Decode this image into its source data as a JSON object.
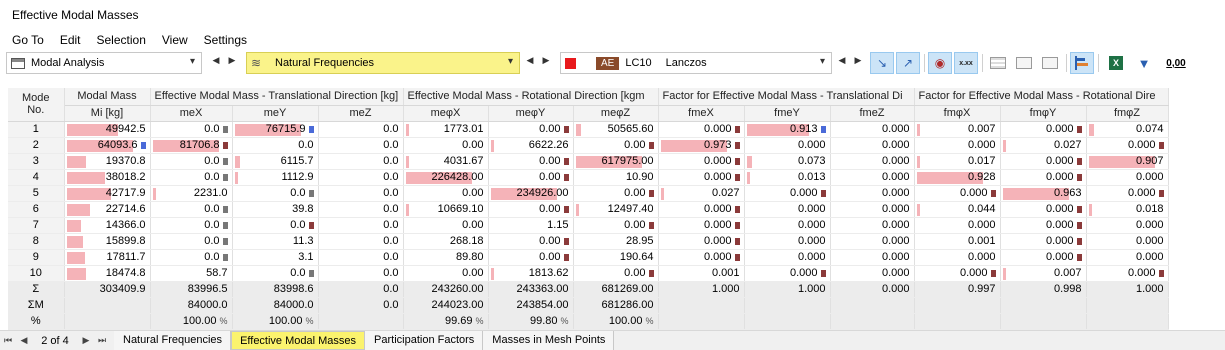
{
  "window": {
    "title": "Effective Modal Masses"
  },
  "menu": [
    "Go To",
    "Edit",
    "Selection",
    "View",
    "Settings"
  ],
  "toolbar": {
    "analysis": "Modal Analysis",
    "result": "Natural Frequencies",
    "lc_badge": "AE",
    "lc_id": "LC10",
    "method": "Lanczos",
    "decimals_label": "0,00"
  },
  "table": {
    "group_headers": [
      "Mode No.",
      "Modal Mass",
      "Effective Modal Mass - Translational Direction [kg]",
      "Effective Modal Mass - Rotational Direction [kgm",
      "Factor for Effective Modal Mass - Translational Di",
      "Factor for Effective Modal Mass - Rotational Dire"
    ],
    "col_headers": [
      "Mi [kg]",
      "meX",
      "meY",
      "meZ",
      "meφX",
      "meφY",
      "meφZ",
      "fmeX",
      "fmeY",
      "fmeZ",
      "fmφX",
      "fmφY",
      "fmφZ"
    ],
    "mode_label_1": "Mode",
    "mode_label_2": "No.",
    "rows": [
      {
        "mode": "1",
        "cells": [
          "49942.5",
          "0.0",
          "76715.9",
          "0.0",
          "1773.01",
          "0.00",
          "50565.60",
          "0.000",
          "0.913",
          "0.000",
          "0.007",
          "0.000",
          "0.074"
        ]
      },
      {
        "mode": "2",
        "cells": [
          "64093.6",
          "81706.8",
          "0.0",
          "0.0",
          "0.00",
          "6622.26",
          "0.00",
          "0.973",
          "0.000",
          "0.000",
          "0.000",
          "0.027",
          "0.000"
        ]
      },
      {
        "mode": "3",
        "cells": [
          "19370.8",
          "0.0",
          "6115.7",
          "0.0",
          "4031.67",
          "0.00",
          "617975.00",
          "0.000",
          "0.073",
          "0.000",
          "0.017",
          "0.000",
          "0.907"
        ]
      },
      {
        "mode": "4",
        "cells": [
          "38018.2",
          "0.0",
          "1112.9",
          "0.0",
          "226428.00",
          "0.00",
          "10.90",
          "0.000",
          "0.013",
          "0.000",
          "0.928",
          "0.000",
          "0.000"
        ]
      },
      {
        "mode": "5",
        "cells": [
          "42717.9",
          "2231.0",
          "0.0",
          "0.0",
          "0.00",
          "234926.00",
          "0.00",
          "0.027",
          "0.000",
          "0.000",
          "0.000",
          "0.963",
          "0.000"
        ]
      },
      {
        "mode": "6",
        "cells": [
          "22714.6",
          "0.0",
          "39.8",
          "0.0",
          "10669.10",
          "0.00",
          "12497.40",
          "0.000",
          "0.000",
          "0.000",
          "0.044",
          "0.000",
          "0.018"
        ]
      },
      {
        "mode": "7",
        "cells": [
          "14366.0",
          "0.0",
          "0.0",
          "0.0",
          "0.00",
          "1.15",
          "0.00",
          "0.000",
          "0.000",
          "0.000",
          "0.000",
          "0.000",
          "0.000"
        ]
      },
      {
        "mode": "8",
        "cells": [
          "15899.8",
          "0.0",
          "11.3",
          "0.0",
          "268.18",
          "0.00",
          "28.95",
          "0.000",
          "0.000",
          "0.000",
          "0.001",
          "0.000",
          "0.000"
        ]
      },
      {
        "mode": "9",
        "cells": [
          "17811.7",
          "0.0",
          "3.1",
          "0.0",
          "89.80",
          "0.00",
          "190.64",
          "0.000",
          "0.000",
          "0.000",
          "0.000",
          "0.000",
          "0.000"
        ]
      },
      {
        "mode": "10",
        "cells": [
          "18474.8",
          "58.7",
          "0.0",
          "0.0",
          "0.00",
          "1813.62",
          "0.00",
          "0.001",
          "0.000",
          "0.000",
          "0.000",
          "0.007",
          "0.000"
        ]
      }
    ],
    "summary": [
      {
        "label": "Σ",
        "cells": [
          "303409.9",
          "83996.5",
          "83998.6",
          "0.0",
          "243260.00",
          "243363.00",
          "681269.00",
          "1.000",
          "1.000",
          "0.000",
          "0.997",
          "0.998",
          "1.000"
        ]
      },
      {
        "label": "ΣM",
        "cells": [
          "",
          "84000.0",
          "84000.0",
          "0.0",
          "244023.00",
          "243854.00",
          "681286.00",
          "",
          "",
          "",
          "",
          "",
          ""
        ]
      },
      {
        "label": "%",
        "cells": [
          "",
          "100.00",
          "100.00",
          "",
          "99.69",
          "99.80",
          "100.00",
          "",
          "",
          "",
          "",
          "",
          ""
        ]
      }
    ],
    "percent_unit": "%"
  },
  "bars": {
    "rows": [
      [
        0.78,
        0,
        1.0,
        0,
        0.01,
        0,
        0.08,
        0,
        0.94,
        0,
        0.01,
        0,
        0.08
      ],
      [
        1.0,
        1.0,
        0,
        0,
        0,
        0.03,
        0,
        1.0,
        0,
        0,
        0,
        0.03,
        0
      ],
      [
        0.3,
        0,
        0.08,
        0,
        0.02,
        0,
        1.0,
        0,
        0.08,
        0,
        0.02,
        0,
        1.0
      ],
      [
        0.59,
        0,
        0.01,
        0,
        1.0,
        0,
        0,
        0,
        0.01,
        0,
        1.0,
        0,
        0
      ],
      [
        0.67,
        0.03,
        0,
        0,
        0,
        1.0,
        0,
        0.03,
        0,
        0,
        0,
        1.0,
        0
      ],
      [
        0.35,
        0,
        0,
        0,
        0.05,
        0,
        0.02,
        0,
        0,
        0,
        0.05,
        0,
        0.02
      ],
      [
        0.22,
        0,
        0,
        0,
        0,
        0,
        0,
        0,
        0,
        0,
        0,
        0,
        0
      ],
      [
        0.25,
        0,
        0,
        0,
        0,
        0,
        0,
        0,
        0,
        0,
        0,
        0,
        0
      ],
      [
        0.28,
        0,
        0,
        0,
        0,
        0,
        0,
        0,
        0,
        0,
        0,
        0,
        0
      ],
      [
        0.29,
        0,
        0,
        0,
        0,
        0.01,
        0,
        0,
        0,
        0,
        0,
        0.01,
        0
      ]
    ],
    "markers": [
      [
        "",
        "g",
        "b",
        "",
        "",
        "r",
        "",
        "r",
        "b",
        "",
        "",
        "r",
        ""
      ],
      [
        "b",
        "r",
        "",
        "",
        "",
        "",
        "r",
        "r",
        "",
        "",
        "",
        "",
        "r"
      ],
      [
        "",
        "g",
        "",
        "",
        "",
        "r",
        "",
        "r",
        "",
        "",
        "",
        "r",
        ""
      ],
      [
        "",
        "g",
        "",
        "",
        "",
        "r",
        "",
        "r",
        "",
        "",
        "",
        "r",
        ""
      ],
      [
        "",
        "",
        "g",
        "",
        "",
        "",
        "r",
        "",
        "r",
        "",
        "r",
        "",
        "r"
      ],
      [
        "",
        "g",
        "",
        "",
        "",
        "r",
        "",
        "r",
        "",
        "",
        "",
        "r",
        ""
      ],
      [
        "",
        "g",
        "r",
        "",
        "",
        "",
        "r",
        "r",
        "",
        "",
        "",
        "r",
        ""
      ],
      [
        "",
        "g",
        "",
        "",
        "",
        "r",
        "",
        "r",
        "",
        "",
        "",
        "r",
        ""
      ],
      [
        "",
        "g",
        "",
        "",
        "",
        "r",
        "",
        "r",
        "",
        "",
        "",
        "r",
        ""
      ],
      [
        "",
        "",
        "g",
        "",
        "",
        "",
        "r",
        "",
        "r",
        "",
        "r",
        "",
        "r"
      ]
    ],
    "color": "#f5b3b8"
  },
  "footer": {
    "page": "2 of 4",
    "tabs": [
      "Natural Frequencies",
      "Effective Modal Masses",
      "Participation Factors",
      "Masses in Mesh Points"
    ],
    "active_tab": 1
  }
}
